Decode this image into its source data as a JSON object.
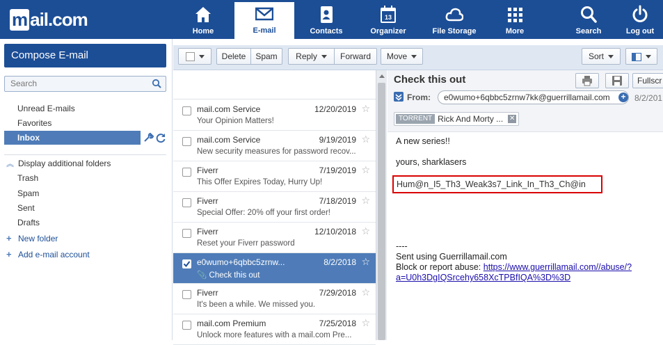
{
  "logo": {
    "text": "mail.com"
  },
  "nav": [
    {
      "label": "Home",
      "icon": "home-icon"
    },
    {
      "label": "E-mail",
      "icon": "envelope-icon"
    },
    {
      "label": "Contacts",
      "icon": "contacts-icon"
    },
    {
      "label": "Organizer",
      "icon": "calendar-icon",
      "day": "13"
    },
    {
      "label": "File Storage",
      "icon": "cloud-icon"
    },
    {
      "label": "More",
      "icon": "grid-icon"
    },
    {
      "label": "Search",
      "icon": "search-icon"
    },
    {
      "label": "Log out",
      "icon": "power-icon"
    }
  ],
  "sidebar": {
    "compose": "Compose E-mail",
    "search_placeholder": "Search",
    "unread": "Unread E-mails",
    "favorites": "Favorites",
    "inbox": "Inbox",
    "display_folders": "Display additional folders",
    "folders": [
      "Trash",
      "Spam",
      "Sent",
      "Drafts"
    ],
    "new_folder": "New folder",
    "add_account": "Add e-mail account"
  },
  "toolbar": {
    "delete": "Delete",
    "spam": "Spam",
    "reply": "Reply",
    "forward": "Forward",
    "move": "Move",
    "sort": "Sort"
  },
  "messages": [
    {
      "from": "mail.com Service",
      "date": "12/20/2019",
      "subject": "Your Opinion Matters!",
      "selected": false
    },
    {
      "from": "mail.com Service",
      "date": "9/19/2019",
      "subject": "New security measures for password recov...",
      "selected": false
    },
    {
      "from": "Fiverr",
      "date": "7/19/2019",
      "subject": "This Offer Expires Today, Hurry Up!",
      "selected": false
    },
    {
      "from": "Fiverr",
      "date": "7/18/2019",
      "subject": "Special Offer: 20% off your first order!",
      "selected": false
    },
    {
      "from": "Fiverr",
      "date": "12/10/2018",
      "subject": "Reset your Fiverr password",
      "selected": false
    },
    {
      "from": "e0wumo+6qbbc5zrnw...",
      "date": "8/2/2018",
      "subject": "Check this out",
      "selected": true
    },
    {
      "from": "Fiverr",
      "date": "7/29/2018",
      "subject": "It's been a while. We missed you.",
      "selected": false
    },
    {
      "from": "mail.com Premium",
      "date": "7/25/2018",
      "subject": "Unlock more features with a mail.com Pre...",
      "selected": false
    }
  ],
  "reader": {
    "title": "Check this out",
    "fullscreen": "Fullscr",
    "from_label": "From:",
    "from": "e0wumo+6qbbc5zrnw7kk@guerrillamail.com",
    "date": "8/2/201",
    "tag_label": "TORRENT",
    "tag_text": "Rick And Morty ...",
    "line1": "A new series!!",
    "line2": "yours, sharklasers",
    "flag": "Hum@n_I5_Th3_Weak3s7_Link_In_Th3_Ch@in",
    "dashes": "----",
    "sent_using": "Sent using Guerrillamail.com",
    "block_prefix": "Block or report abuse: ",
    "link1": "https://www.guerrillamail.com//abuse/?",
    "link2": "a=U0h3DgIQSrcehy658XcTPBfIQA%3D%3D"
  },
  "colors": {
    "brand": "#1c4e96",
    "selection": "#4f7cb8",
    "alert_box": "#d90000"
  }
}
